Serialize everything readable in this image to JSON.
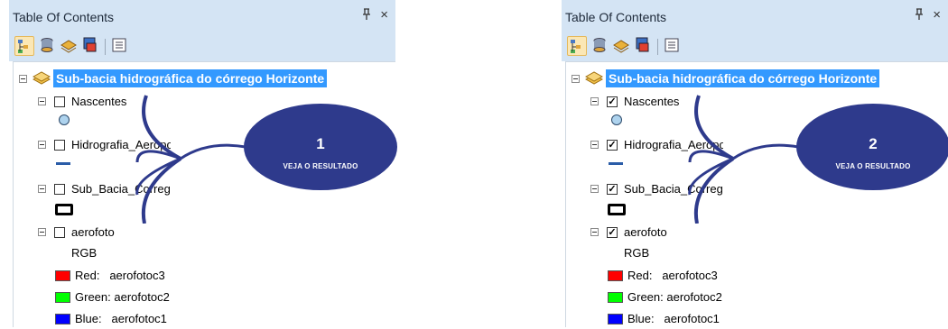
{
  "colors": {
    "panel_bg": "#d4e4f4",
    "selection": "#3399ff",
    "callout": "#2e3a8c",
    "red": "#ff0000",
    "green": "#00ff00",
    "blue": "#0000ff"
  },
  "panels": [
    {
      "title": "Table Of Contents",
      "pin": "ᵖ",
      "close": "×",
      "group_label": "Sub-bacia hidrográfica do córrego Horizonte",
      "layers": [
        {
          "name": "Nascentes",
          "checked": false
        },
        {
          "name": "Hidrografia_Aeroporto",
          "checked": false
        },
        {
          "name": "Sub_Bacia_Corrego_Horizonte",
          "checked": false
        },
        {
          "name": "aerofoto",
          "checked": false
        }
      ],
      "rgb_label": "RGB",
      "bands": [
        {
          "label": "Red:",
          "value": "aerofotoc3"
        },
        {
          "label": "Green:",
          "value": "aerofotoc2"
        },
        {
          "label": "Blue:",
          "value": "aerofotoc1"
        }
      ],
      "callout_number": "1",
      "callout_text": "VEJA O RESULTADO"
    },
    {
      "title": "Table Of Contents",
      "pin": "ᵖ",
      "close": "×",
      "group_label": "Sub-bacia hidrográfica do córrego Horizonte",
      "layers": [
        {
          "name": "Nascentes",
          "checked": true
        },
        {
          "name": "Hidrografia_Aeroporto",
          "checked": true
        },
        {
          "name": "Sub_Bacia_Corrego_Horizonte",
          "checked": true
        },
        {
          "name": "aerofoto",
          "checked": true
        }
      ],
      "rgb_label": "RGB",
      "bands": [
        {
          "label": "Red:",
          "value": "aerofotoc3"
        },
        {
          "label": "Green:",
          "value": "aerofotoc2"
        },
        {
          "label": "Blue:",
          "value": "aerofotoc1"
        }
      ],
      "callout_number": "2",
      "callout_text": "VEJA O RESULTADO"
    }
  ],
  "icons": {
    "list_by_drawing_order": "list-drawing-order-icon",
    "list_by_source": "list-by-source-icon",
    "list_by_visibility": "list-by-visibility-icon",
    "list_by_selection": "list-by-selection-icon",
    "options": "options-icon"
  }
}
